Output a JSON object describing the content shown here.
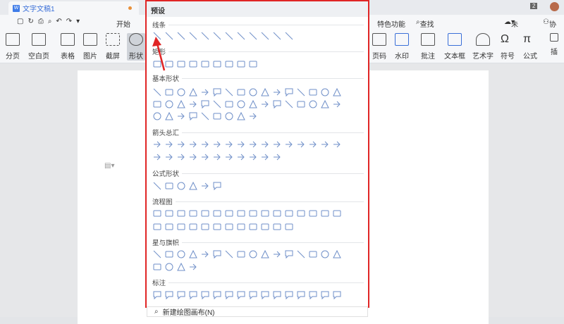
{
  "tab": {
    "title": "文字文稿1",
    "badge": "2"
  },
  "quick": {
    "start": "开始",
    "features": "特色功能",
    "search": "查找命令、搜索模板",
    "unsaved": "未保存",
    "collab": "协作"
  },
  "ribbon": {
    "left": [
      "分页",
      "空白页",
      "表格",
      "图片",
      "截屏",
      "形状"
    ],
    "right": [
      "页码",
      "水印",
      "批注",
      "文本框",
      "艺术字",
      "符号",
      "公式",
      "插"
    ]
  },
  "panel": {
    "header": "预设",
    "sections": [
      {
        "title": "线条",
        "rows": [
          12
        ]
      },
      {
        "title": "矩形",
        "rows": [
          9
        ]
      },
      {
        "title": "基本形状",
        "rows": [
          16,
          16,
          9
        ]
      },
      {
        "title": "箭头总汇",
        "rows": [
          16,
          11
        ]
      },
      {
        "title": "公式形状",
        "rows": [
          6
        ]
      },
      {
        "title": "流程图",
        "rows": [
          16,
          12
        ]
      },
      {
        "title": "星与旗帜",
        "rows": [
          16,
          4
        ]
      },
      {
        "title": "标注",
        "rows": [
          16
        ]
      }
    ],
    "new_canvas": "新建绘图画布(N)"
  },
  "colors": {
    "accent": "#e02525",
    "shape": "#6f8fc8"
  }
}
